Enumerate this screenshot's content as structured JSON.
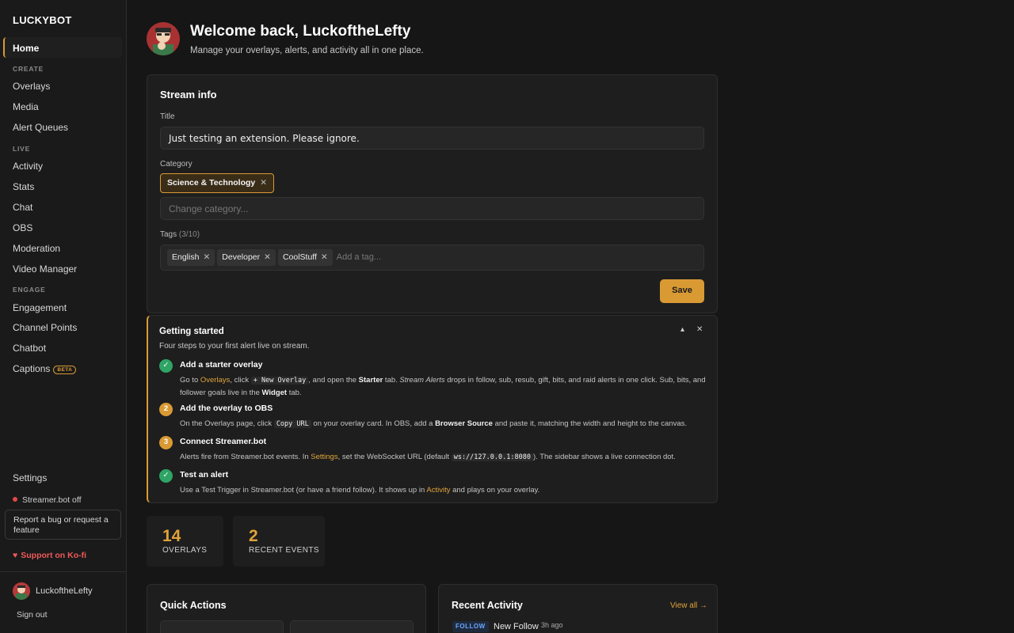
{
  "app": {
    "brand": "LUCKYBOT"
  },
  "sidebar": {
    "home": "Home",
    "sections": {
      "create": "CREATE",
      "live": "LIVE",
      "engage": "ENGAGE"
    },
    "create_items": [
      "Overlays",
      "Media",
      "Alert Queues"
    ],
    "live_items": [
      "Activity",
      "Stats",
      "Chat",
      "OBS",
      "Moderation",
      "Video Manager"
    ],
    "engage_items": [
      "Engagement",
      "Channel Points",
      "Chatbot",
      "Captions"
    ],
    "captions_badge": "BETA",
    "settings": "Settings",
    "status": "Streamer.bot off",
    "status_color": "#e24848",
    "bug_report": "Report a bug or request a feature",
    "kofi": "Support on Ko-fi",
    "user_name": "LuckoftheLefty",
    "sign_out": "Sign out"
  },
  "header": {
    "title": "Welcome back, LuckoftheLefty",
    "subtitle": "Manage your overlays, alerts, and activity all in one place."
  },
  "stream_info": {
    "heading": "Stream info",
    "title_label": "Title",
    "title_value": "Just testing an extension. Please ignore.",
    "category_label": "Category",
    "category_value": "Science & Technology",
    "category_placeholder": "Change category...",
    "tags_label": "Tags",
    "tags_count": "(3/10)",
    "tags": [
      "English",
      "Developer",
      "CoolStuff"
    ],
    "tag_placeholder": "Add a tag...",
    "save": "Save"
  },
  "getting_started": {
    "title": "Getting started",
    "subtitle": "Four steps to your first alert live on stream.",
    "steps": [
      {
        "status": "done",
        "title": "Add a starter overlay",
        "t1": "Go to ",
        "link": "Overlays",
        "t2": ", click ",
        "code": "+ New Overlay",
        "t3": ", and open the ",
        "bold1": "Starter",
        "t4": " tab. ",
        "italic": "Stream Alerts",
        "t5": " drops in follow, sub, resub, gift, bits, and raid alerts in one click. Sub, bits, and follower goals live in the ",
        "bold2": "Widget",
        "t6": " tab."
      },
      {
        "status": "pending",
        "number": "2",
        "title": "Add the overlay to OBS",
        "t1": "On the Overlays page, click ",
        "code": "Copy URL",
        "t2": " on your overlay card. In OBS, add a ",
        "bold": "Browser Source",
        "t3": " and paste it, matching the width and height to the canvas."
      },
      {
        "status": "pending",
        "number": "3",
        "title": "Connect Streamer.bot",
        "t1": "Alerts fire from Streamer.bot events. In ",
        "link": "Settings",
        "t2": ", set the WebSocket URL (default ",
        "code": "ws://127.0.0.1:8080",
        "t3": "). The sidebar shows a live connection dot."
      },
      {
        "status": "done",
        "title": "Test an alert",
        "t1": "Use a Test Trigger in Streamer.bot (or have a friend follow). It shows up in ",
        "link": "Activity",
        "t2": " and plays on your overlay."
      }
    ]
  },
  "stats": [
    {
      "value": "14",
      "label": "OVERLAYS"
    },
    {
      "value": "2",
      "label": "RECENT EVENTS"
    }
  ],
  "quick_actions": {
    "title": "Quick Actions"
  },
  "recent_activity": {
    "title": "Recent Activity",
    "view_all": "View all →",
    "events": [
      {
        "type": "FOLLOW",
        "text": "New Follow",
        "time": "3h ago"
      }
    ]
  },
  "colors": {
    "accent": "#d99a34",
    "success": "#2fa565",
    "follow_badge": "#6aa6ff",
    "kofi": "#f05a5a"
  }
}
